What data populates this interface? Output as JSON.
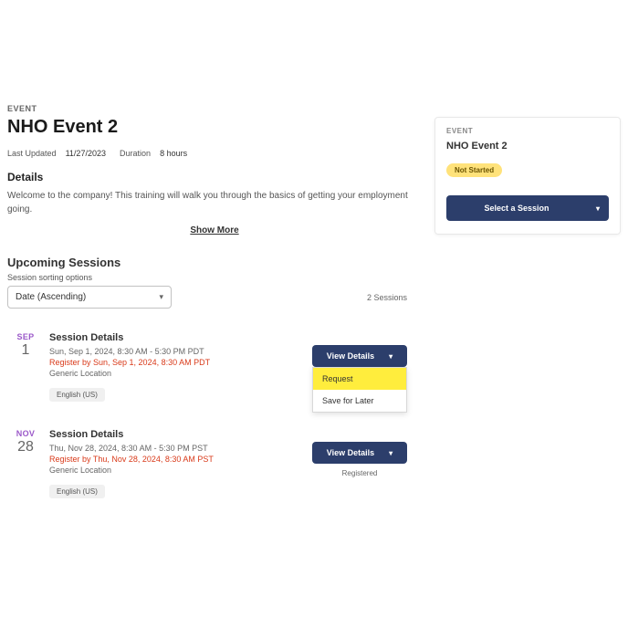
{
  "event": {
    "eyebrow": "EVENT",
    "title": "NHO Event 2",
    "lastUpdated": {
      "label": "Last Updated",
      "value": "11/27/2023"
    },
    "duration": {
      "label": "Duration",
      "value": "8 hours"
    }
  },
  "details": {
    "heading": "Details",
    "description": "Welcome to the company! This training will walk you through the basics of getting your employment going.",
    "showMore": "Show More"
  },
  "upcoming": {
    "heading": "Upcoming Sessions",
    "sortLabel": "Session sorting options",
    "sortValue": "Date (Ascending)",
    "count": "2 Sessions"
  },
  "sessions": [
    {
      "month": "SEP",
      "day": "1",
      "title": "Session Details",
      "time": "Sun, Sep 1, 2024, 8:30 AM - 5:30 PM PDT",
      "registerBy": "Register by Sun, Sep 1, 2024, 8:30 AM PDT",
      "location": "Generic Location",
      "language": "English (US)",
      "viewDetails": "View Details",
      "menu": {
        "request": "Request",
        "save": "Save for Later"
      }
    },
    {
      "month": "NOV",
      "day": "28",
      "title": "Session Details",
      "time": "Thu, Nov 28, 2024, 8:30 AM - 5:30 PM PST",
      "registerBy": "Register by Thu, Nov 28, 2024, 8:30 AM PST",
      "location": "Generic Location",
      "language": "English (US)",
      "viewDetails": "View Details",
      "registered": "Registered"
    }
  ],
  "sidebar": {
    "eyebrow": "EVENT",
    "title": "NHO Event 2",
    "status": "Not Started",
    "selectSession": "Select a Session"
  }
}
